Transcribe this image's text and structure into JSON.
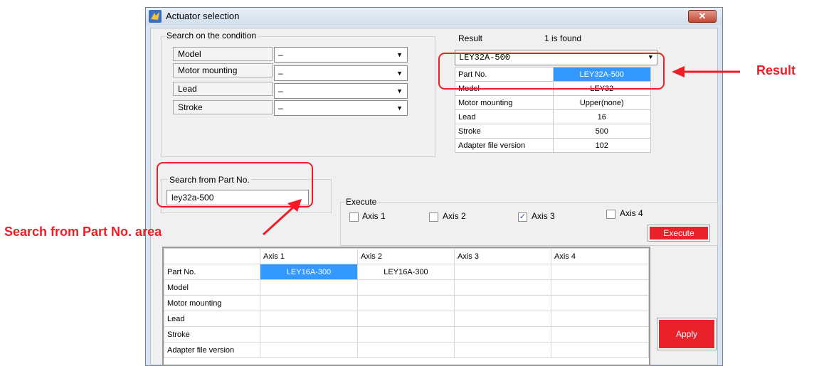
{
  "window": {
    "title": "Actuator selection",
    "close_glyph": "✕"
  },
  "condition": {
    "legend": "Search on the condition",
    "rows": [
      {
        "label": "Model",
        "value": "–"
      },
      {
        "label": "Motor mounting",
        "value": "–"
      },
      {
        "label": "Lead",
        "value": "–"
      },
      {
        "label": "Stroke",
        "value": "–"
      }
    ]
  },
  "result": {
    "label": "Result",
    "count_text": "1 is found",
    "selected": "LEY32A-500",
    "table": [
      {
        "key": "Part No.",
        "value": "LEY32A-500"
      },
      {
        "key": "Model",
        "value": "LEY32"
      },
      {
        "key": "Motor mounting",
        "value": "Upper(none)"
      },
      {
        "key": "Lead",
        "value": "16"
      },
      {
        "key": "Stroke",
        "value": "500"
      },
      {
        "key": "Adapter file version",
        "value": "102"
      }
    ]
  },
  "part_search": {
    "legend": "Search from Part No.",
    "value": "ley32a-500"
  },
  "execute": {
    "legend": "Execute",
    "axes": [
      {
        "label": "Axis 1",
        "checked": false
      },
      {
        "label": "Axis 2",
        "checked": false
      },
      {
        "label": "Axis 3",
        "checked": true
      },
      {
        "label": "Axis 4",
        "checked": false
      }
    ],
    "button": "Execute",
    "check_glyph": "✓"
  },
  "grid": {
    "columns": [
      "Axis 1",
      "Axis 2",
      "Axis 3",
      "Axis 4"
    ],
    "rows": [
      {
        "label": "Part No.",
        "cells": [
          "LEY16A-300",
          "LEY16A-300",
          "",
          ""
        ]
      },
      {
        "label": "Model",
        "cells": [
          "",
          "",
          "",
          ""
        ]
      },
      {
        "label": "Motor mounting",
        "cells": [
          "",
          "",
          "",
          ""
        ]
      },
      {
        "label": "Lead",
        "cells": [
          "",
          "",
          "",
          ""
        ]
      },
      {
        "label": "Stroke",
        "cells": [
          "",
          "",
          "",
          ""
        ]
      },
      {
        "label": "Adapter file version",
        "cells": [
          "",
          "",
          "",
          ""
        ]
      }
    ]
  },
  "apply_button": "Apply",
  "annotations": {
    "result": "Result",
    "part_search": "Search from Part No. area"
  },
  "colors": {
    "accent_red": "#ee1c25",
    "button_red": "#e8212a",
    "selection_blue": "#3399ff"
  }
}
